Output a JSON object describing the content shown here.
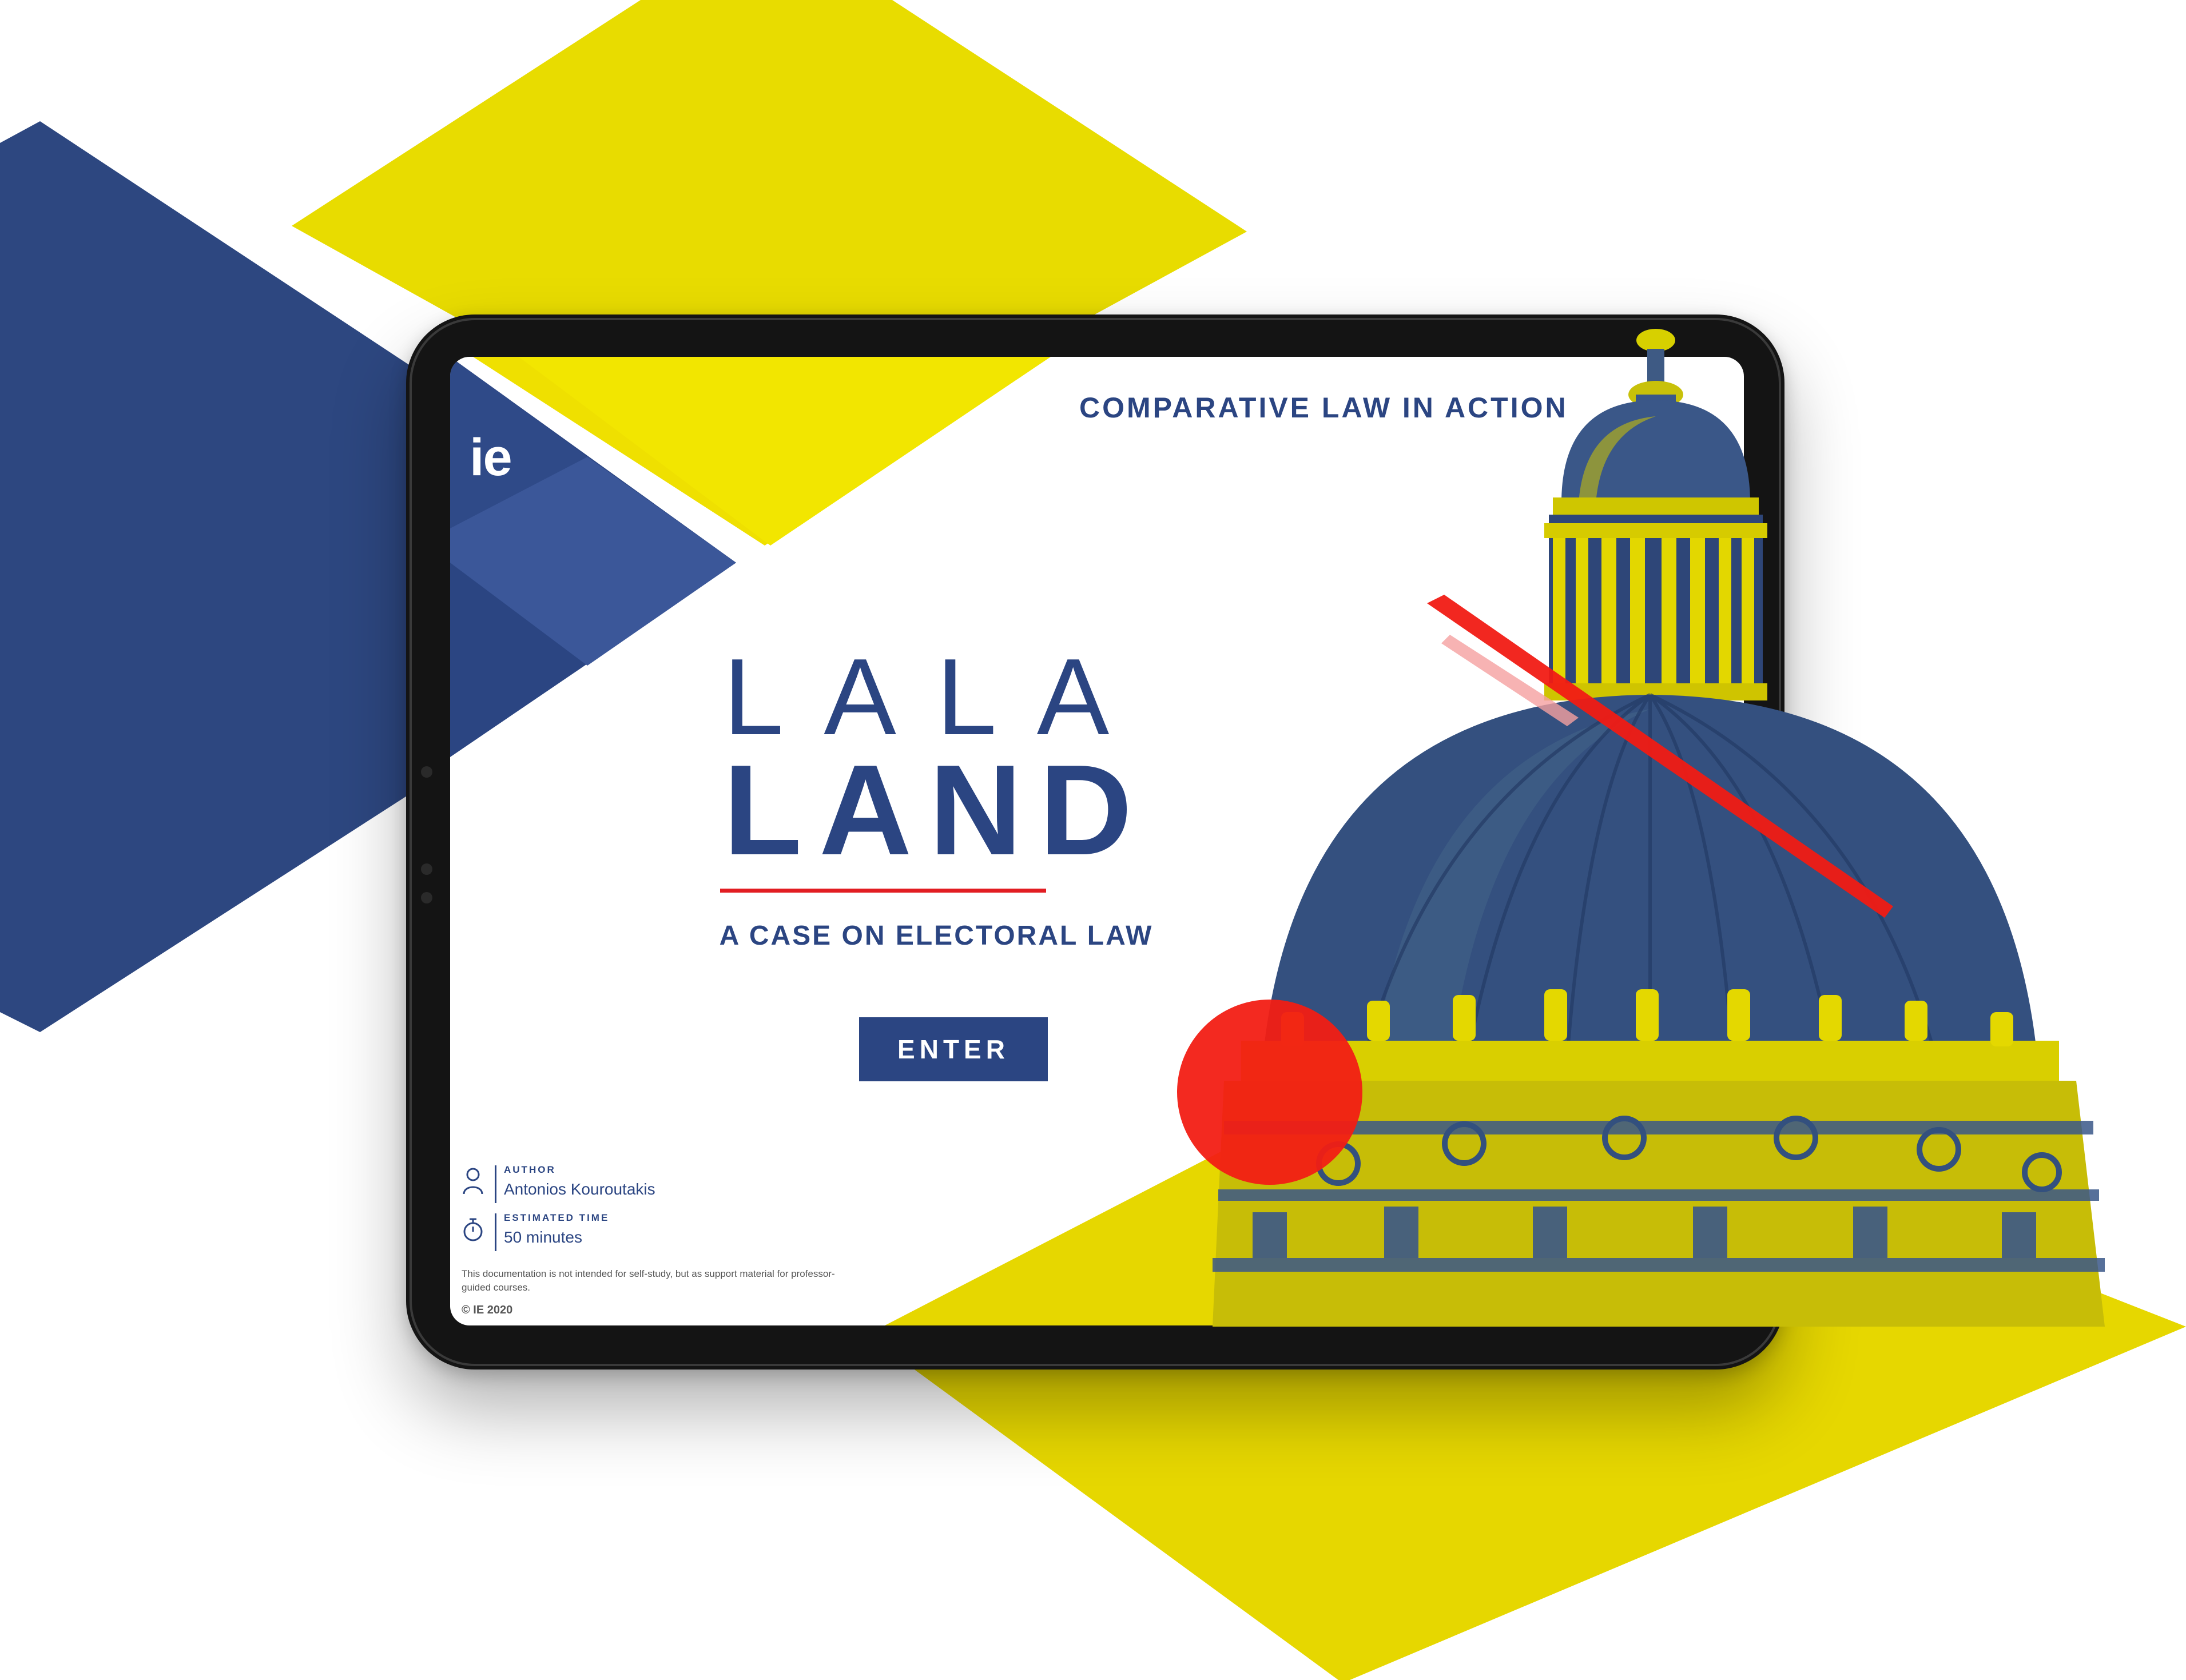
{
  "colors": {
    "navy": "#2b4582",
    "yellow": "#e8dc00",
    "red": "#e21d22",
    "blue_triangle": "#3b5799",
    "white": "#ffffff"
  },
  "screen": {
    "logo": "ie",
    "course_title": "COMPARATIVE LAW IN ACTION",
    "title_light": "LALA",
    "title_bold": "LAND",
    "subtitle": "A CASE ON ELECTORAL LAW",
    "enter_label": "ENTER",
    "author": {
      "label": "AUTHOR",
      "value": "Antonios Kouroutakis",
      "icon": "person-icon"
    },
    "estimated_time": {
      "label": "ESTIMATED TIME",
      "value": "50 minutes",
      "icon": "stopwatch-icon"
    },
    "disclaimer": "This documentation is not intended for self-study, but as support material for professor-guided courses.",
    "copyright": "© IE 2020",
    "hero_image": "capitol-dome-duotone"
  }
}
